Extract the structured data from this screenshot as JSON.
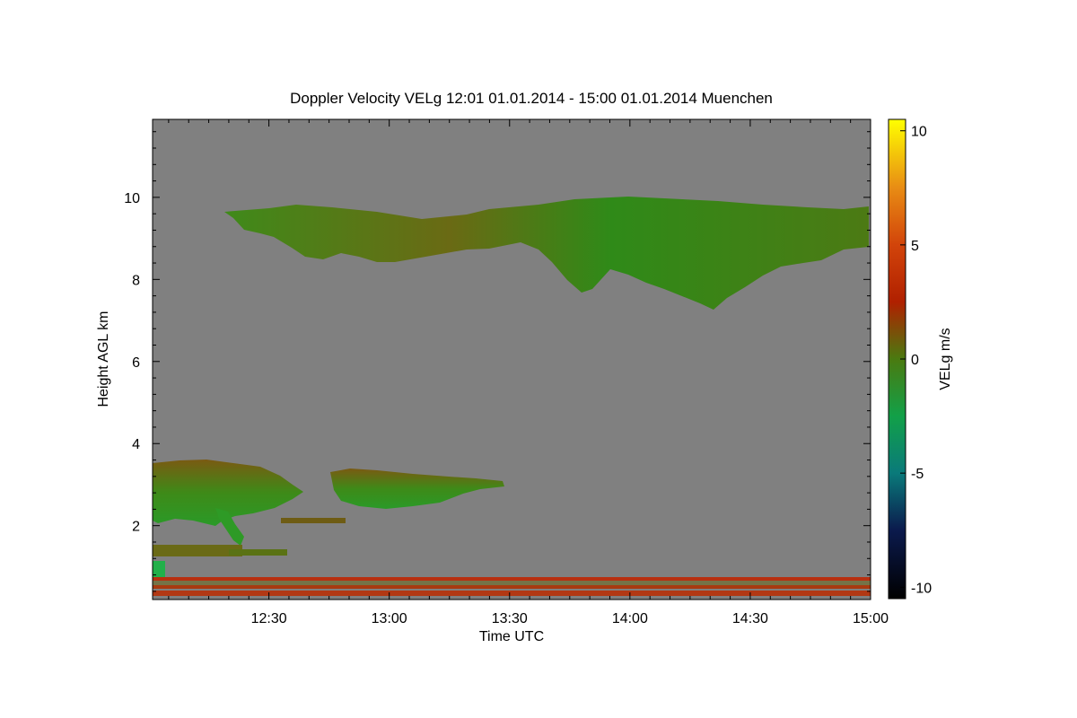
{
  "chart_data": {
    "type": "heatmap",
    "title": "Doppler Velocity VELg   12:01 01.01.2014 - 15:00 01.01.2014 Muenchen",
    "xlabel": "Time UTC",
    "ylabel": "Height AGL km",
    "colorbar_label": "VELg m/s",
    "x_range": [
      "12:01",
      "15:00"
    ],
    "xticks": [
      "12:30",
      "13:00",
      "13:30",
      "14:00",
      "14:30",
      "15:00"
    ],
    "y_range_km": [
      0.2,
      11.9
    ],
    "yticks": [
      "2",
      "4",
      "6",
      "8",
      "10"
    ],
    "colorbar_range": [
      -10.5,
      10.5
    ],
    "colorbar_ticks": [
      "10",
      "5",
      "0",
      "-5",
      "-10"
    ],
    "background_value_color": "#808080",
    "colormap": [
      {
        "v": -10.5,
        "color": "#000000"
      },
      {
        "v": -7.5,
        "color": "#0b1a4d"
      },
      {
        "v": -5,
        "color": "#0a7a7a"
      },
      {
        "v": -2.5,
        "color": "#12a048"
      },
      {
        "v": 0,
        "color": "#4a7a10"
      },
      {
        "v": 2.5,
        "color": "#b02000"
      },
      {
        "v": 5,
        "color": "#d2440a"
      },
      {
        "v": 7.5,
        "color": "#e88c14"
      },
      {
        "v": 10.5,
        "color": "#ffff00"
      }
    ],
    "cloud_regions": [
      {
        "name": "cirrus layer",
        "t_start": "12:20",
        "t_end": "15:00",
        "base_km": 8.7,
        "top_km": 10.1,
        "mean_velocity": -0.5,
        "lowest_base_km": 7.4
      },
      {
        "name": "mid-level cloud A",
        "t_start": "12:01",
        "t_end": "12:38",
        "base_km": 2.2,
        "top_km": 3.6,
        "mean_velocity": -1.0
      },
      {
        "name": "mid-level cloud B",
        "t_start": "12:45",
        "t_end": "13:28",
        "base_km": 2.4,
        "top_km": 3.3,
        "mean_velocity": -0.5
      },
      {
        "name": "low cloud",
        "t_start": "12:01",
        "t_end": "12:35",
        "base_km": 1.2,
        "top_km": 1.5,
        "mean_velocity": 0.5
      },
      {
        "name": "near-surface clutter bands",
        "t_start": "12:01",
        "t_end": "15:00",
        "base_km": 0.2,
        "top_km": 0.7,
        "mean_velocity": 2.0
      }
    ]
  }
}
